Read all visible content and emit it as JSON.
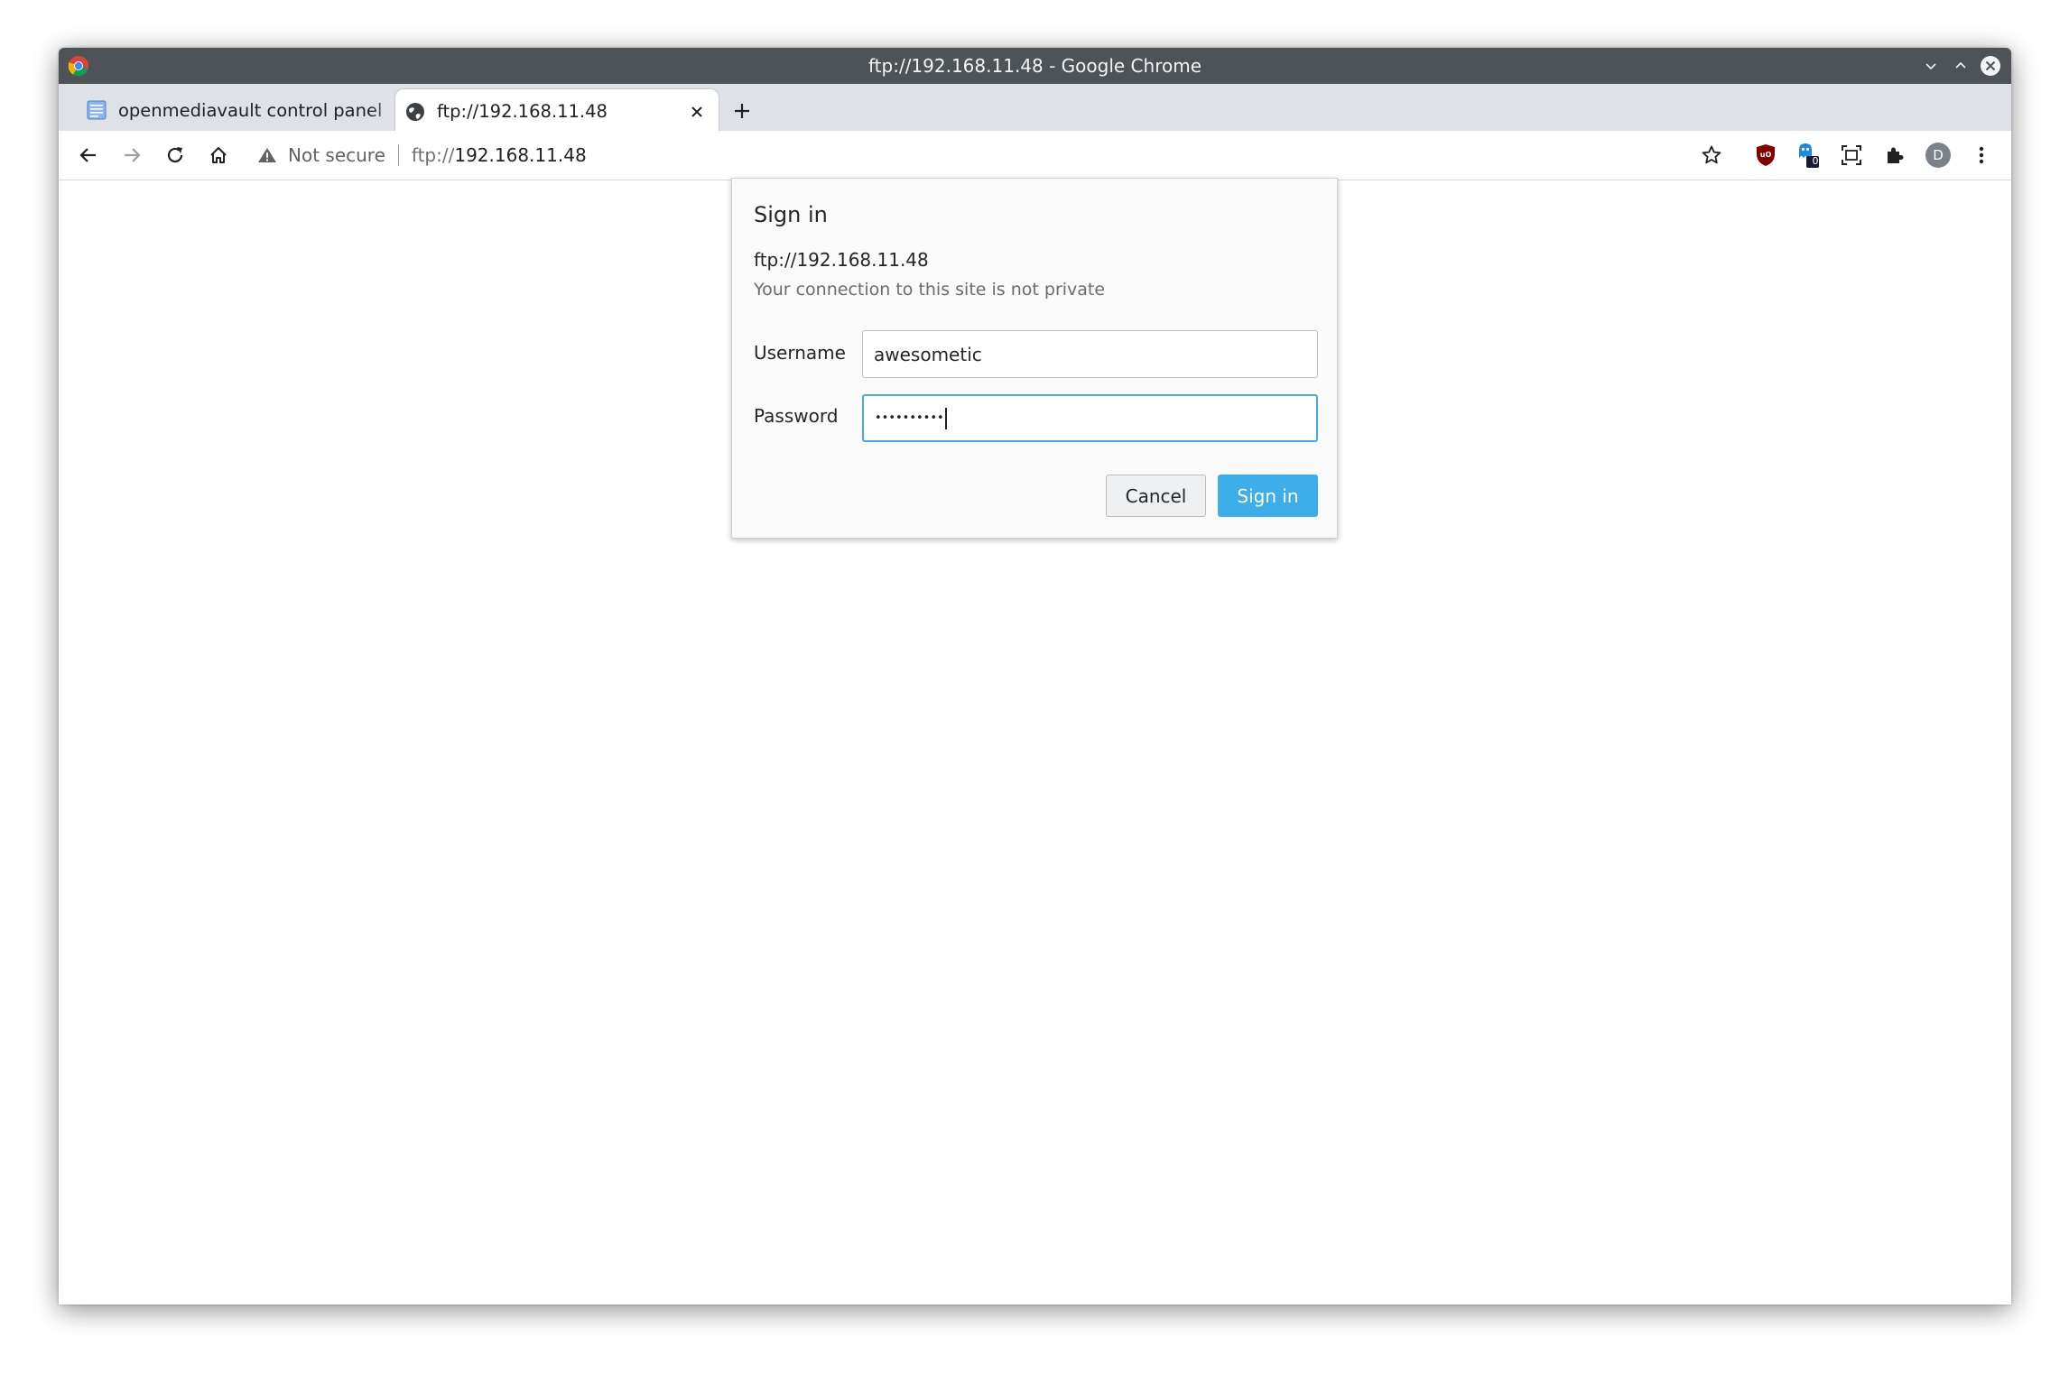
{
  "window": {
    "title": "ftp://192.168.11.48 - Google Chrome"
  },
  "tabs": [
    {
      "label": "openmediavault control panel",
      "active": false
    },
    {
      "label": "ftp://192.168.11.48",
      "active": true
    }
  ],
  "omnibox": {
    "security_label": "Not secure",
    "url_scheme": "ftp://",
    "url_host": "192.168.11.48"
  },
  "extensions": {
    "badge_count": "0",
    "profile_initial": "D"
  },
  "dialog": {
    "title": "Sign in",
    "url": "ftp://192.168.11.48",
    "note": "Your connection to this site is not private",
    "username_label": "Username",
    "username_value": "awesometic",
    "password_label": "Password",
    "password_mask": "••••••••••",
    "cancel_label": "Cancel",
    "signin_label": "Sign in"
  },
  "colors": {
    "titlebar": "#4e5357",
    "tabstrip": "#dee1e6",
    "accent": "#3daee9",
    "ublock_red": "#800000"
  }
}
